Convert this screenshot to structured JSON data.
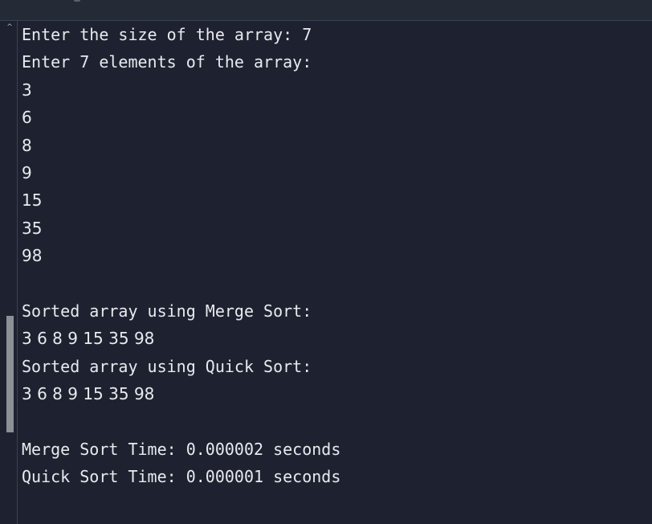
{
  "terminal": {
    "prompt_size": "Enter the size of the array: 7",
    "prompt_elements": "Enter 7 elements of the array:",
    "inputs": [
      "3",
      "6",
      "8",
      "9",
      "15",
      "35",
      "98"
    ],
    "merge_heading": "Sorted array using Merge Sort:",
    "merge_result": "3 6 8 9 15 35 98",
    "quick_heading": "Sorted array using Quick Sort:",
    "quick_result": "3 6 8 9 15 35 98",
    "merge_time": "Merge Sort Time: 0.000002 seconds",
    "quick_time": "Quick Sort Time: 0.000001 seconds"
  },
  "scrollbar": {
    "up_glyph": "^"
  },
  "colors": {
    "background": "#1e2230",
    "text": "#e8eaee",
    "scroll_thumb": "#8c8f96"
  }
}
